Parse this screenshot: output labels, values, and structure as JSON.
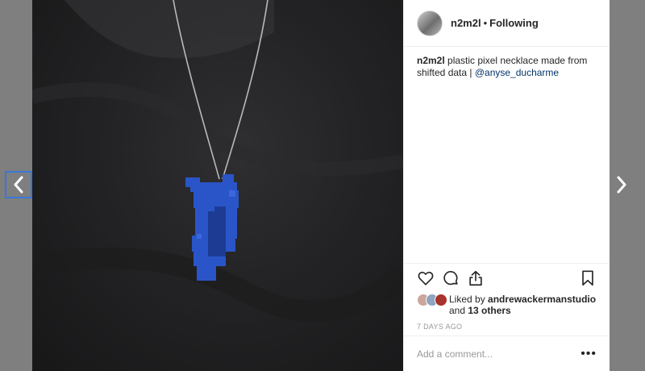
{
  "post": {
    "username": "n2m2l",
    "follow_status": "Following",
    "caption_user": "n2m2l",
    "caption_text": " plastic pixel necklace made from shifted data | ",
    "caption_mention": "@anyse_ducharme",
    "likes_prefix": "Liked by ",
    "likes_user": "andrewackermanstudio",
    "likes_and": " and ",
    "likes_others": "13 others",
    "timestamp": "7 DAYS AGO"
  },
  "comment": {
    "placeholder": "Add a comment..."
  },
  "icons": {
    "prev": "chevron-left-icon",
    "next": "chevron-right-icon",
    "like": "heart-icon",
    "comment": "comment-icon",
    "share": "share-icon",
    "save": "bookmark-icon",
    "more": "more-icon"
  },
  "colors": {
    "pendant_blue": "#2a55c8",
    "mention": "#003569",
    "nav_focus": "#3a78d8"
  }
}
